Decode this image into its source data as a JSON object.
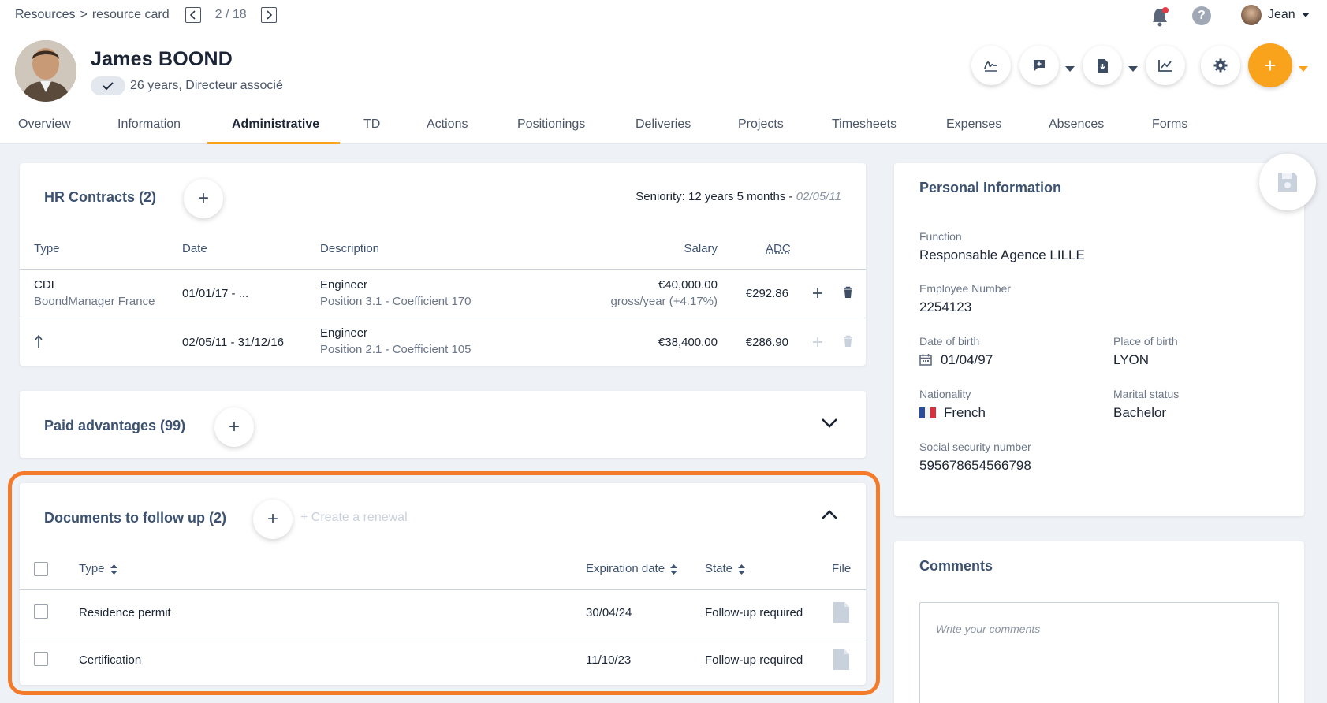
{
  "breadcrumb": {
    "root": "Resources",
    "separator": ">",
    "current": "resource card"
  },
  "pager": {
    "count": "2 / 18"
  },
  "user": {
    "name": "Jean"
  },
  "profile": {
    "name": "James BOOND",
    "subtitle": "26 years, Directeur associé"
  },
  "tabs": [
    {
      "label": "Overview"
    },
    {
      "label": "Information"
    },
    {
      "label": "Administrative"
    },
    {
      "label": "TD"
    },
    {
      "label": "Actions"
    },
    {
      "label": "Positionings"
    },
    {
      "label": "Deliveries"
    },
    {
      "label": "Projects"
    },
    {
      "label": "Timesheets"
    },
    {
      "label": "Expenses"
    },
    {
      "label": "Absences"
    },
    {
      "label": "Forms"
    }
  ],
  "hr_contracts": {
    "title": "HR Contracts (2)",
    "seniority": "Seniority: 12 years 5 months - ",
    "seniority_date": "02/05/11",
    "columns": {
      "type": "Type",
      "date": "Date",
      "description": "Description",
      "salary": "Salary",
      "adc": "ADC"
    },
    "rows": [
      {
        "type": "CDI",
        "type_sub": "BoondManager France",
        "date": "01/01/17 - ...",
        "description": "Engineer",
        "description_sub": "Position 3.1 - Coefficient 170",
        "salary": "€40,000.00",
        "salary_sub": "gross/year (+4.17%)",
        "adc": "€292.86"
      },
      {
        "type": "",
        "type_sub": "",
        "date": "02/05/11 - 31/12/16",
        "description": "Engineer",
        "description_sub": "Position 2.1 - Coefficient 105",
        "salary": "€38,400.00",
        "salary_sub": "",
        "adc": "€286.90"
      }
    ]
  },
  "paid_advantages": {
    "title": "Paid advantages (99)"
  },
  "documents": {
    "title": "Documents to follow up (2)",
    "create_renewal": "+ Create a renewal",
    "columns": {
      "type": "Type",
      "expiration": "Expiration date",
      "state": "State",
      "file": "File"
    },
    "rows": [
      {
        "type": "Residence permit",
        "expiration": "30/04/24",
        "state": "Follow-up required"
      },
      {
        "type": "Certification",
        "expiration": "11/10/23",
        "state": "Follow-up required"
      }
    ]
  },
  "personal_info": {
    "title": "Personal Information",
    "function_label": "Function",
    "function_value": "Responsable Agence LILLE",
    "employee_label": "Employee Number",
    "employee_value": "2254123",
    "dob_label": "Date of birth",
    "dob_value": "01/04/97",
    "pob_label": "Place of birth",
    "pob_value": "LYON",
    "nationality_label": "Nationality",
    "nationality_value": "French",
    "marital_label": "Marital status",
    "marital_value": "Bachelor",
    "ssn_label": "Social security number",
    "ssn_value": "595678654566798"
  },
  "comments": {
    "title": "Comments",
    "placeholder": "Write your comments"
  },
  "colors": {
    "accent": "#f9a21b",
    "highlight": "#f47b2a",
    "title": "#3d5270"
  }
}
